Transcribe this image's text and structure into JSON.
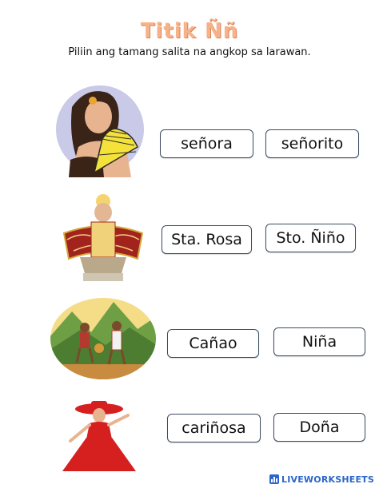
{
  "worksheet": {
    "title": "Titik Ññ",
    "instruction": "Piliin ang tamang salita na angkop sa larawan."
  },
  "rows": [
    {
      "image": "woman-with-fan-image",
      "options": [
        "señora",
        "señorito"
      ]
    },
    {
      "image": "santo-nino-statue-image",
      "options": [
        "Sta. Rosa",
        "Sto. Ñiño"
      ]
    },
    {
      "image": "canao-dancers-image",
      "options": [
        "Cañao",
        "Niña"
      ]
    },
    {
      "image": "lady-in-red-dress-image",
      "options": [
        "cariñosa",
        "Doña"
      ]
    }
  ],
  "footer": {
    "brand": "LIVEWORKSHEETS"
  },
  "colors": {
    "title": "#f6b38a",
    "button_border": "#3c4c62",
    "brand": "#2b66c9"
  }
}
